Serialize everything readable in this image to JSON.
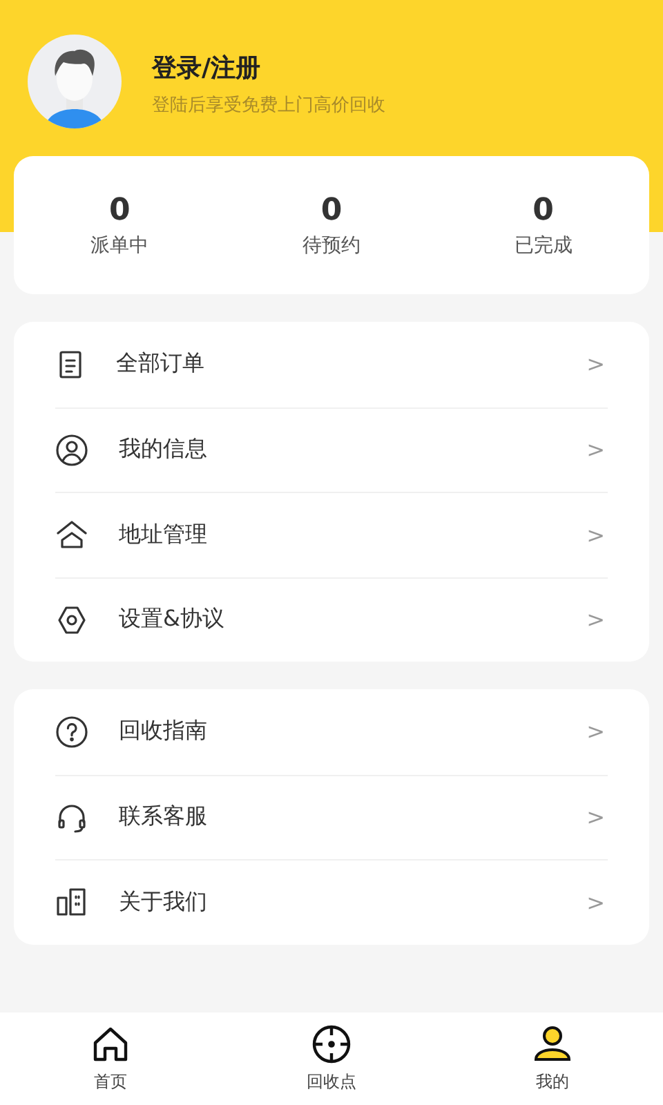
{
  "profile": {
    "title": "登录/注册",
    "subtitle": "登陆后享受免费上门高价回收"
  },
  "stats": [
    {
      "value": "0",
      "label": "派单中"
    },
    {
      "value": "0",
      "label": "待预约"
    },
    {
      "value": "0",
      "label": "已完成"
    }
  ],
  "menu_groups": [
    [
      {
        "label": "全部订单",
        "chevron": ">"
      },
      {
        "label": "我的信息",
        "chevron": ">"
      },
      {
        "label": "地址管理",
        "chevron": ">"
      },
      {
        "label": "设置&协议",
        "chevron": ">"
      }
    ],
    [
      {
        "label": "回收指南",
        "chevron": ">"
      },
      {
        "label": "联系客服",
        "chevron": ">"
      },
      {
        "label": "关于我们",
        "chevron": ">"
      }
    ]
  ],
  "tab_bar": [
    {
      "label": "首页",
      "selected": false
    },
    {
      "label": "回收点",
      "selected": false
    },
    {
      "label": "我的",
      "selected": true
    }
  ]
}
